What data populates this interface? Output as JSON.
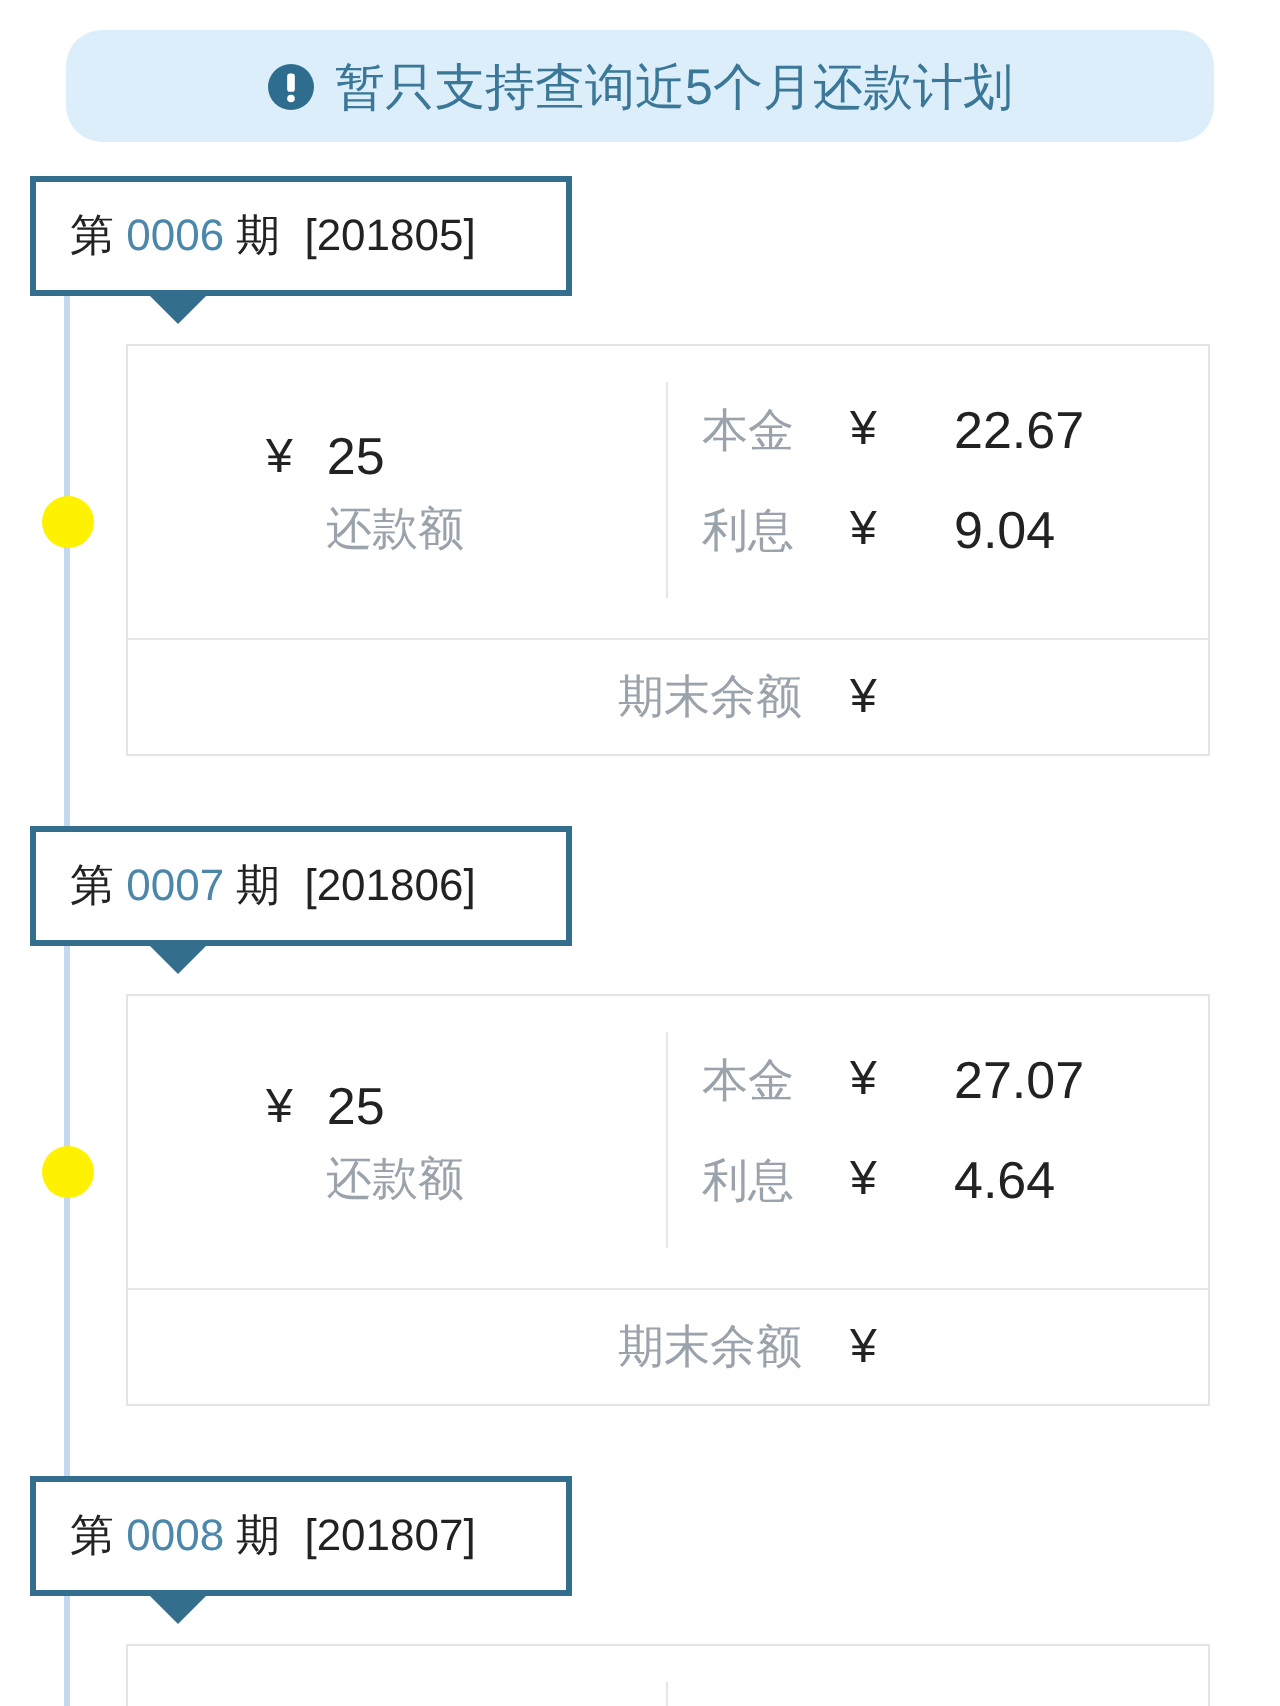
{
  "notice": {
    "text": "暂只支持查询近5个月还款计划"
  },
  "periods": [
    {
      "prefix": "第",
      "number": "0006",
      "suffix": "期",
      "month": "[201805]",
      "amount_currency": "¥",
      "amount": "25",
      "amount_label": "还款额",
      "breakdown": [
        {
          "label": "本金",
          "currency": "¥",
          "value": "22.67"
        },
        {
          "label": "利息",
          "currency": "¥",
          "value": "9.04"
        }
      ],
      "balance": {
        "label": "期末余额",
        "currency": "¥"
      }
    },
    {
      "prefix": "第",
      "number": "0007",
      "suffix": "期",
      "month": "[201806]",
      "amount_currency": "¥",
      "amount": "25",
      "amount_label": "还款额",
      "breakdown": [
        {
          "label": "本金",
          "currency": "¥",
          "value": "27.07"
        },
        {
          "label": "利息",
          "currency": "¥",
          "value": "4.64"
        }
      ],
      "balance": {
        "label": "期末余额",
        "currency": "¥"
      }
    },
    {
      "prefix": "第",
      "number": "0008",
      "suffix": "期",
      "month": "[201807]"
    }
  ]
}
